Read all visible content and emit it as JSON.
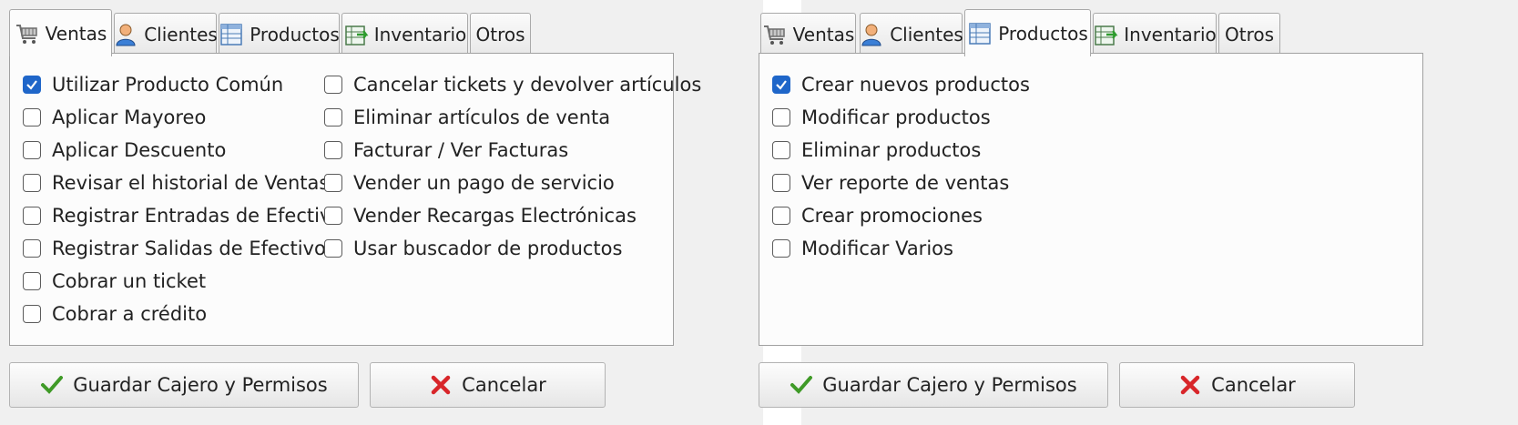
{
  "left": {
    "tabs": [
      {
        "label": "Ventas",
        "icon": "cart-icon"
      },
      {
        "label": "Clientes",
        "icon": "user-icon"
      },
      {
        "label": "Productos",
        "icon": "table-icon"
      },
      {
        "label": "Inventario",
        "icon": "inventory-icon"
      },
      {
        "label": "Otros",
        "icon": ""
      }
    ],
    "active_tab": "Ventas",
    "column1": [
      {
        "label": "Utilizar Producto Común",
        "checked": true
      },
      {
        "label": "Aplicar Mayoreo",
        "checked": false
      },
      {
        "label": "Aplicar Descuento",
        "checked": false
      },
      {
        "label": "Revisar el historial de Ventas",
        "checked": false
      },
      {
        "label": "Registrar Entradas de Efectivo",
        "checked": false
      },
      {
        "label": "Registrar Salidas de Efectivo",
        "checked": false
      },
      {
        "label": "Cobrar un ticket",
        "checked": false
      },
      {
        "label": "Cobrar a crédito",
        "checked": false
      }
    ],
    "column2": [
      {
        "label": "Cancelar tickets y devolver artículos",
        "checked": false
      },
      {
        "label": "Eliminar artículos de venta",
        "checked": false
      },
      {
        "label": "Facturar / Ver Facturas",
        "checked": false
      },
      {
        "label": "Vender un pago de servicio",
        "checked": false
      },
      {
        "label": "Vender Recargas Electrónicas",
        "checked": false
      },
      {
        "label": "Usar buscador de productos",
        "checked": false
      }
    ],
    "save_label": "Guardar Cajero y Permisos",
    "cancel_label": "Cancelar"
  },
  "right": {
    "tabs": [
      {
        "label": "Ventas",
        "icon": "cart-icon"
      },
      {
        "label": "Clientes",
        "icon": "user-icon"
      },
      {
        "label": "Productos",
        "icon": "table-icon"
      },
      {
        "label": "Inventario",
        "icon": "inventory-icon"
      },
      {
        "label": "Otros",
        "icon": ""
      }
    ],
    "active_tab": "Productos",
    "items": [
      {
        "label": "Crear nuevos productos",
        "checked": true
      },
      {
        "label": "Modificar productos",
        "checked": false
      },
      {
        "label": "Eliminar productos",
        "checked": false
      },
      {
        "label": "Ver reporte de ventas",
        "checked": false
      },
      {
        "label": "Crear promociones",
        "checked": false
      },
      {
        "label": "Modificar Varios",
        "checked": false
      }
    ],
    "save_label": "Guardar Cajero y Permisos",
    "cancel_label": "Cancelar"
  },
  "colors": {
    "checkbox_checked": "#1f66c9",
    "save_check_icon": "#3f9a27",
    "cancel_x_icon": "#d8262a"
  }
}
